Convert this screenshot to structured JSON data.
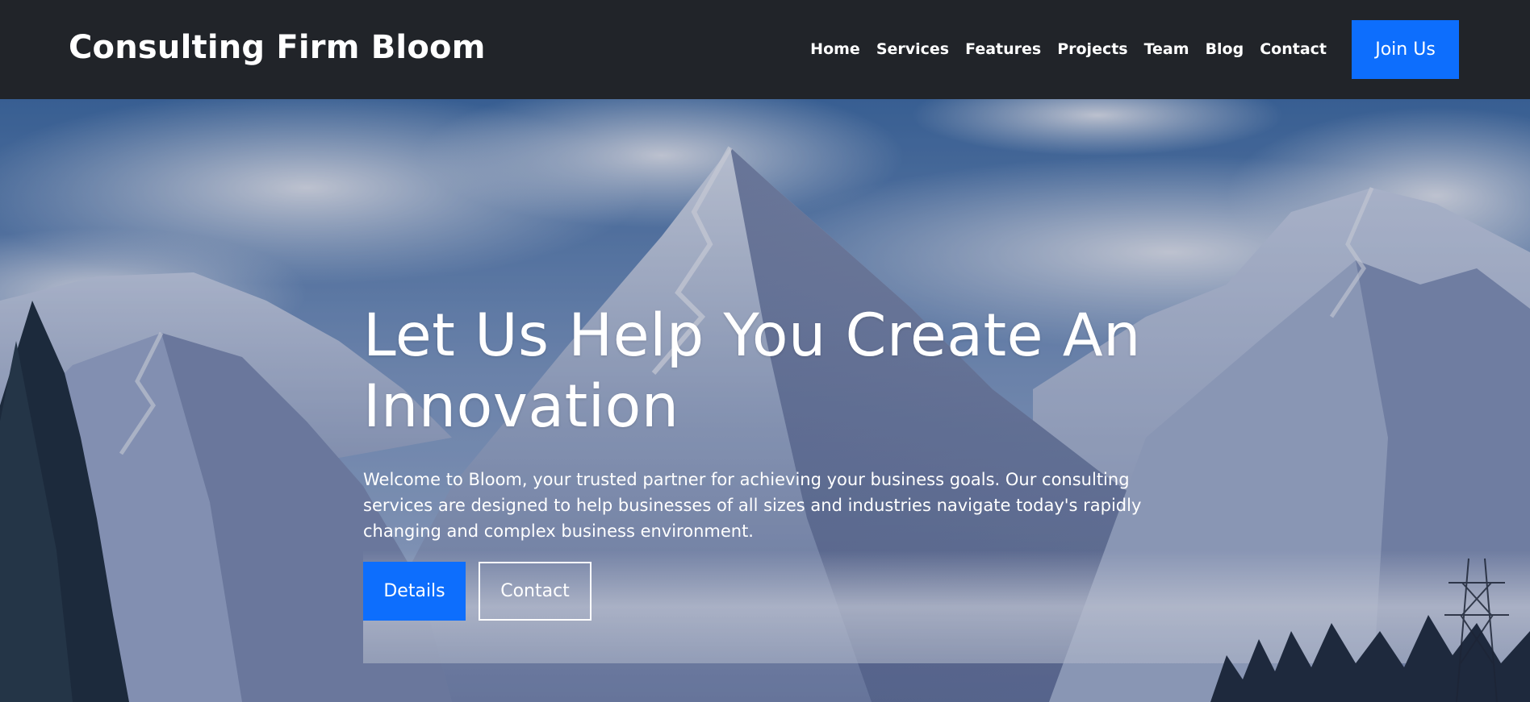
{
  "header": {
    "brand": "Consulting Firm Bloom",
    "nav_items": [
      "Home",
      "Services",
      "Features",
      "Projects",
      "Team",
      "Blog",
      "Contact"
    ],
    "cta_label": "Join Us"
  },
  "hero": {
    "title": "Let Us Help You Create An Innovation",
    "description": "Welcome to Bloom, your trusted partner for achieving your business goals. Our consulting services are designed to help businesses of all sizes and industries navigate today's rapidly changing and complex business environment.",
    "primary_button": "Details",
    "secondary_button": "Contact",
    "background": "snowy-mountain-photo"
  },
  "colors": {
    "navbar_bg": "#212429",
    "accent": "#0d6efd",
    "text": "#ffffff"
  }
}
